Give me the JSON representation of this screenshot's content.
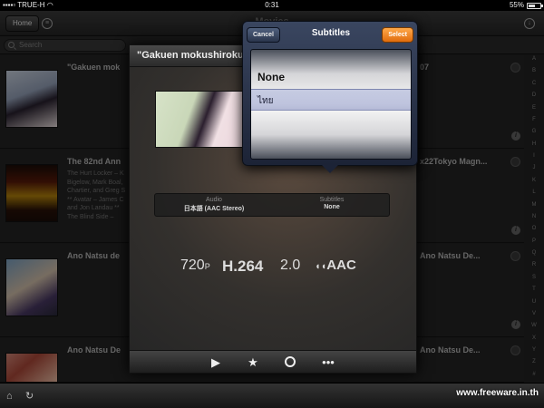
{
  "status_bar": {
    "carrier": "TRUE-H",
    "time": "0:31",
    "battery": "55%"
  },
  "nav": {
    "home_label": "Home",
    "title": "Movies"
  },
  "search": {
    "placeholder": "Search"
  },
  "list": [
    {
      "title_left": "\"Gakuen mok",
      "title_right": "07",
      "description": ""
    },
    {
      "title_left": "The 82nd Ann",
      "title_right": "x22Tokyo Magn...",
      "description": "The Hurt Locker – K Bigelow, Mark Boal, Chartier, and Greg S ** Avatar – James C and Jon Landau ** The Blind Side – "
    },
    {
      "title_left": "Ano Natsu de",
      "title_right": "Ano Natsu De...",
      "description": ""
    },
    {
      "title_left": "Ano Natsu De",
      "title_right": "Ano Natsu De...",
      "description": ""
    }
  ],
  "index_letters": [
    "A",
    "B",
    "C",
    "D",
    "E",
    "F",
    "G",
    "H",
    "I",
    "J",
    "K",
    "L",
    "M",
    "N",
    "O",
    "P",
    "Q",
    "R",
    "S",
    "T",
    "U",
    "V",
    "W",
    "X",
    "Y",
    "Z",
    "#"
  ],
  "modal": {
    "title": "\"Gakuen mokushiroku",
    "audio_label": "Audio",
    "audio_value": "日本語 (AAC Stereo)",
    "subtitles_label": "Subtitles",
    "subtitles_value": "None",
    "spec_resolution": "720",
    "spec_resolution_suffix": "P",
    "spec_codec": "H.264",
    "spec_channels": "2.0",
    "spec_audio_codec": "AAC"
  },
  "popover": {
    "title": "Subtitles",
    "cancel_label": "Cancel",
    "select_label": "Select",
    "options": [
      "None",
      "ไทย"
    ],
    "selected_index": 1
  },
  "watermark": "www.freeware.in.th",
  "colors": {
    "accent": "#f08a24",
    "popover": "#2a3450",
    "background": "#232323"
  }
}
